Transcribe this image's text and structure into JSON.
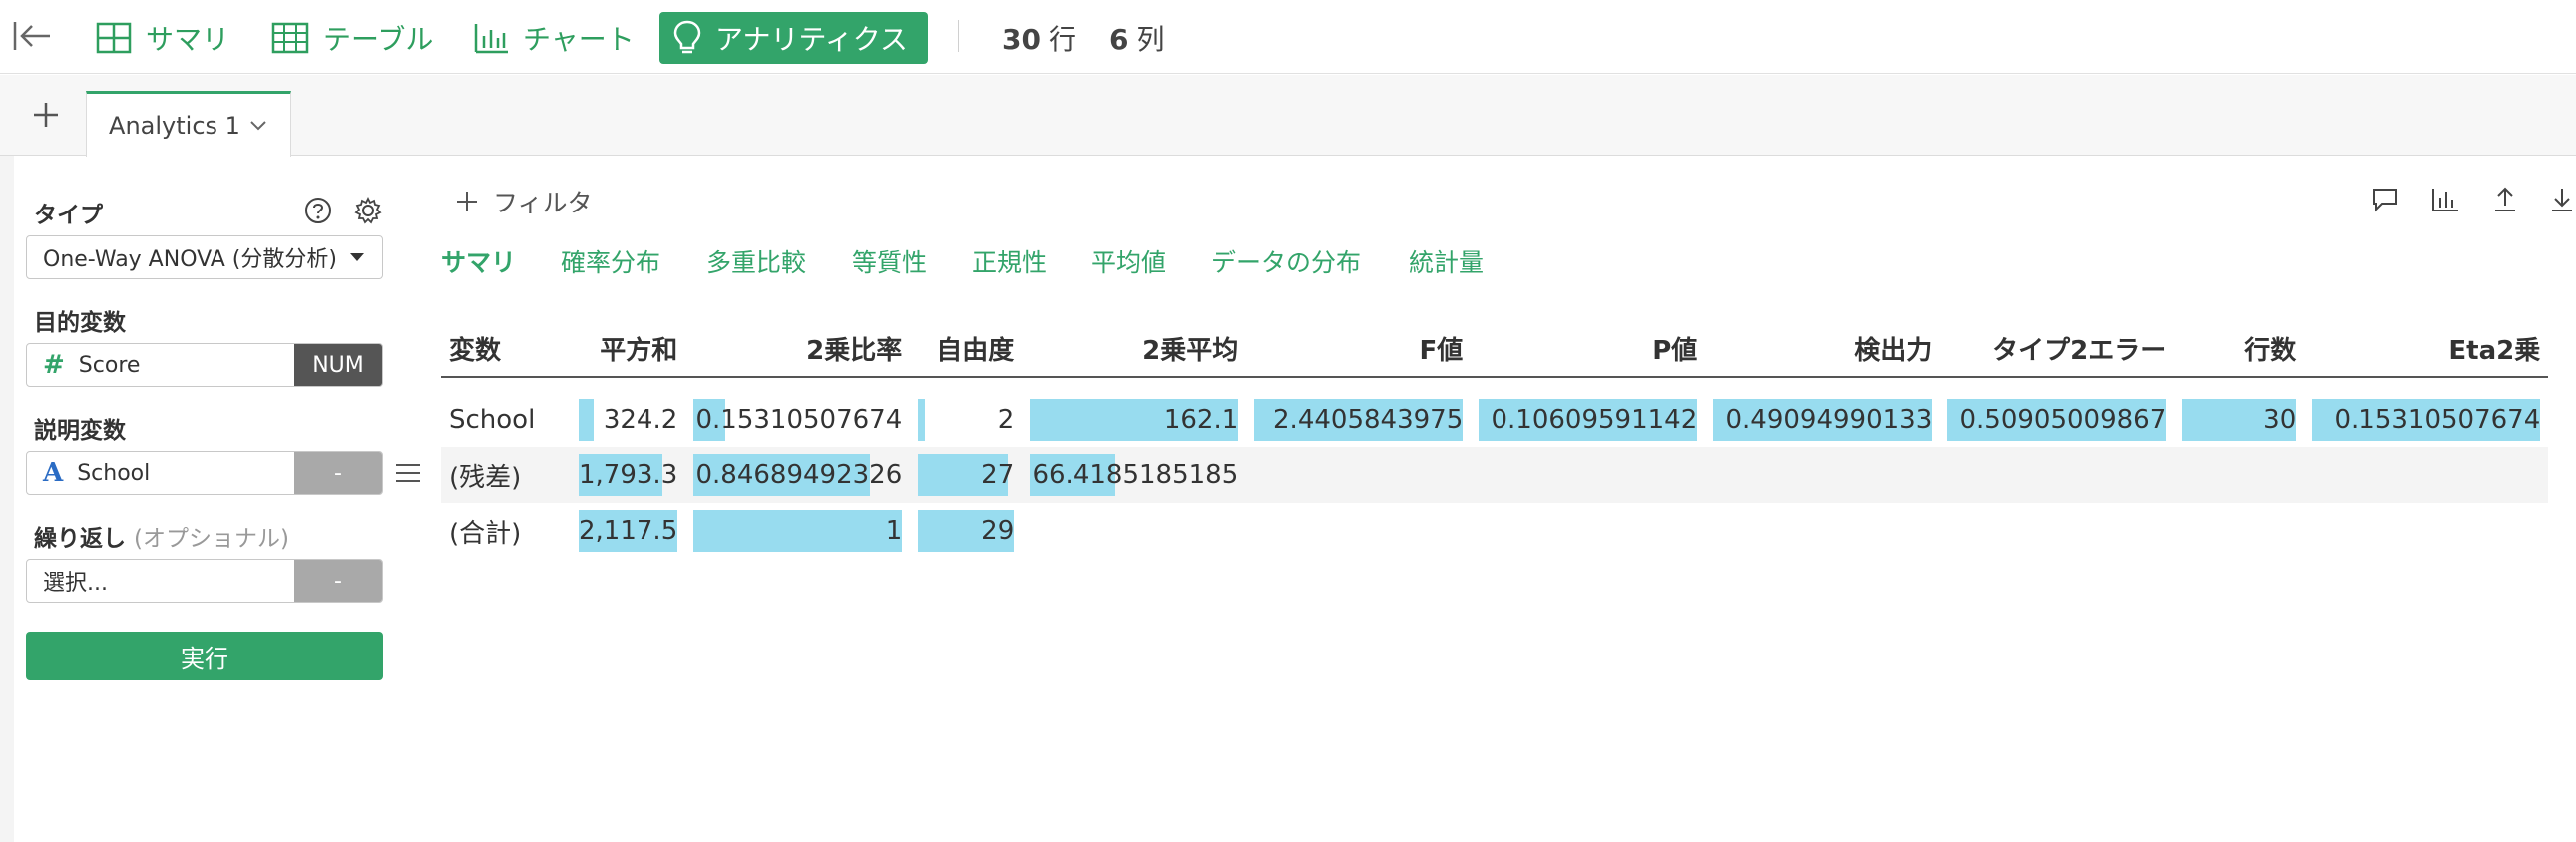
{
  "toolbar": {
    "nav": [
      {
        "label": "サマリ",
        "icon": "summary-grid-icon"
      },
      {
        "label": "テーブル",
        "icon": "table-icon"
      },
      {
        "label": "チャート",
        "icon": "bar-chart-icon"
      },
      {
        "label": "アナリティクス",
        "icon": "lightbulb-icon"
      }
    ],
    "rows_count": "30",
    "rows_unit": "行",
    "cols_count": "6",
    "cols_unit": "列",
    "accent_color": "#33a46a"
  },
  "tabs": [
    {
      "label": "Analytics 1"
    }
  ],
  "panel": {
    "type_label": "タイプ",
    "type_value": "One-Way ANOVA (分散分析)",
    "target_label": "目的変数",
    "target_value": "Score",
    "target_tag": "NUM",
    "explain_label": "説明変数",
    "explain_value": "School",
    "explain_tag": "-",
    "repeat_label": "繰り返し",
    "repeat_optional": "(オプショナル)",
    "repeat_placeholder": "選択...",
    "repeat_tag": "-",
    "run_label": "実行"
  },
  "main": {
    "filter_label": "フィルタ",
    "subtabs": [
      "サマリ",
      "確率分布",
      "多重比較",
      "等質性",
      "正規性",
      "平均値",
      "データの分布",
      "統計量"
    ],
    "active_subtab": "サマリ",
    "table": {
      "headers": [
        "変数",
        "平方和",
        "2乗比率",
        "自由度",
        "2乗平均",
        "F値",
        "P値",
        "検出力",
        "タイプ2エラー",
        "行数",
        "Eta2乗"
      ],
      "rows": [
        {
          "var": "School",
          "cells": [
            {
              "text": "324.2",
              "fill": 0.153
            },
            {
              "text": "0.15310507674",
              "fill": 0.153
            },
            {
              "text": "2",
              "fill": 0.069
            },
            {
              "text": "162.1",
              "fill": 1.0
            },
            {
              "text": "2.4405843975",
              "fill": 1.0
            },
            {
              "text": "0.10609591142",
              "fill": 1.0
            },
            {
              "text": "0.49094990133",
              "fill": 1.0
            },
            {
              "text": "0.50905009867",
              "fill": 1.0
            },
            {
              "text": "30",
              "fill": 1.0
            },
            {
              "text": "0.15310507674",
              "fill": 1.0
            }
          ]
        },
        {
          "var": "(残差)",
          "cells": [
            {
              "text": "1,793.3",
              "fill": 0.847
            },
            {
              "text": "0.84689492326",
              "fill": 0.847
            },
            {
              "text": "27",
              "fill": 0.931
            },
            {
              "text": "66.4185185185",
              "fill": 0.41
            },
            {
              "text": "",
              "fill": 0
            },
            {
              "text": "",
              "fill": 0
            },
            {
              "text": "",
              "fill": 0
            },
            {
              "text": "",
              "fill": 0
            },
            {
              "text": "",
              "fill": 0
            },
            {
              "text": "",
              "fill": 0
            }
          ]
        },
        {
          "var": "(合計)",
          "cells": [
            {
              "text": "2,117.5",
              "fill": 1.0
            },
            {
              "text": "1",
              "fill": 1.0
            },
            {
              "text": "29",
              "fill": 1.0
            },
            {
              "text": "",
              "fill": 0
            },
            {
              "text": "",
              "fill": 0
            },
            {
              "text": "",
              "fill": 0
            },
            {
              "text": "",
              "fill": 0
            },
            {
              "text": "",
              "fill": 0
            },
            {
              "text": "",
              "fill": 0
            },
            {
              "text": "",
              "fill": 0
            }
          ]
        }
      ],
      "bar_color": "#98dcef"
    }
  }
}
